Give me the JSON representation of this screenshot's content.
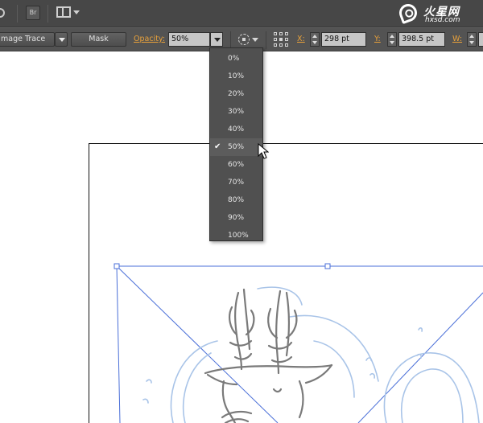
{
  "menubar": {
    "bridge_label": "Br",
    "logo_title": "火星网",
    "logo_sub": "hxsd.com"
  },
  "controlbar": {
    "image_trace_label": "mage Trace",
    "mask_label": "Mask",
    "opacity_label": "Opacity:",
    "opacity_value": "50%",
    "x_label": "X:",
    "x_value": "298 pt",
    "y_label": "Y:",
    "y_value": "398.5 pt",
    "w_label": "W:"
  },
  "opacity_menu": {
    "selected": "50%",
    "items": [
      "0%",
      "10%",
      "20%",
      "30%",
      "40%",
      "50%",
      "60%",
      "70%",
      "80%",
      "90%",
      "100%"
    ]
  },
  "colors": {
    "selection": "#4a6fd8",
    "sketch": "#7a7a7a",
    "sketch_blue": "#a9c4e8",
    "accent_label": "#e9a23b"
  }
}
